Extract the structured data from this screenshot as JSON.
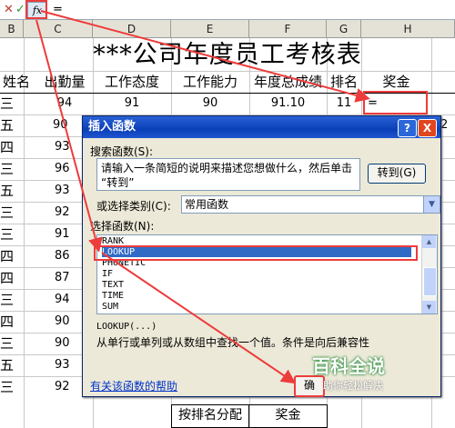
{
  "formula_bar": {
    "cancel": "✕",
    "enter": "✓",
    "fx": "fx",
    "equals": "="
  },
  "columns": [
    "B",
    "C",
    "D",
    "E",
    "F",
    "G",
    "H"
  ],
  "sheet": {
    "title": "***公司年度员工考核表",
    "headers": [
      "姓名",
      "出勤量",
      "工作态度",
      "工作能力",
      "年度总成绩",
      "排名",
      "奖金"
    ],
    "first_row": {
      "name": "三",
      "attendance": "94",
      "attitude": "91",
      "ability": "90",
      "total": "91.10",
      "rank": "11",
      "bonus": "="
    },
    "row2_partial": {
      "name": "五",
      "attendance": "90",
      "rank": "2"
    },
    "names": [
      "四",
      "三",
      "五",
      "三",
      "三",
      "四",
      "四",
      "三",
      "四",
      "三",
      "五",
      "三",
      "三"
    ],
    "attendance": [
      "93",
      "96",
      "93",
      "92",
      "91",
      "86",
      "87",
      "94",
      "90",
      "90",
      "93",
      "92",
      "91",
      "90"
    ]
  },
  "dialog": {
    "title": "插入函数",
    "help_btn": "?",
    "close_btn": "X",
    "search_label": "搜索函数(S):",
    "search_text_line1": "请输入一条简短的说明来描述您想做什么，然后单击",
    "search_text_line2": "“转到”",
    "go_button": "转到(G)",
    "category_label": "或选择类别(C):",
    "category_value": "常用函数",
    "select_label": "选择函数(N):",
    "functions": [
      "RANK",
      "LOOKUP",
      "PHONETIC",
      "IF",
      "TEXT",
      "TIME",
      "SUM"
    ],
    "selected_function": "LOOKUP",
    "signature": "LOOKUP(...)",
    "description": "从单行或单列或从数组中查找一个值。条件是向后兼容性",
    "help_link": "有关该函数的帮助",
    "ok_button": "确"
  },
  "bottom_table": {
    "col1": "按排名分配",
    "col2": "奖金"
  },
  "watermark": {
    "title": "百科全说",
    "subtitle": "助你轻松解决"
  },
  "colors": {
    "annotation_red": "#ee3b3b",
    "selection_blue": "#316ac5",
    "title_bar_blue": "#0a3fb8"
  }
}
